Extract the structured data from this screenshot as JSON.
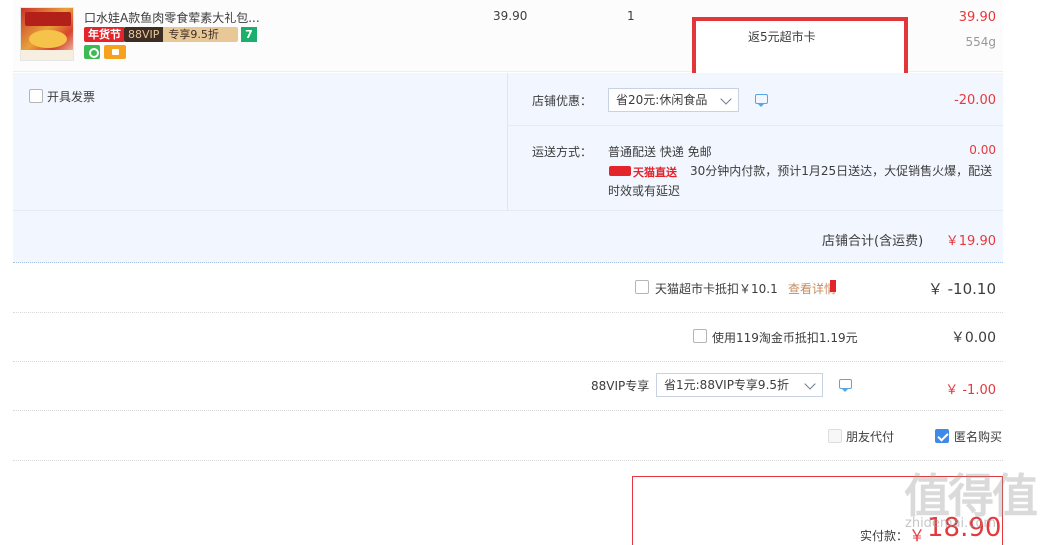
{
  "product": {
    "title": "口水娃A款鱼肉零食荤素大礼包...",
    "tag_festival": "年货节",
    "tag_vip_brand": "88VIP",
    "tag_vip_discount": "专享9.5折",
    "tag_seven": "7",
    "unit_price": "39.90",
    "quantity": "1",
    "rebate": "返5元超市卡",
    "total_price": "39.90",
    "weight": "554g"
  },
  "invoice": {
    "label": "开具发票"
  },
  "shop_discount": {
    "label": "店铺优惠：",
    "selected": "省20元:休闲食品",
    "amount": "-20.00"
  },
  "shipping": {
    "label": "运送方式：",
    "method": "普通配送 快递 免邮",
    "fee": "0.00",
    "tmall_direct": "天猫直送",
    "notice_line1": "30分钟内付款，预计1月25日送达，大促销售火爆，配送",
    "notice_line2": "时效或有延迟"
  },
  "shop_total": {
    "label": "店铺合计(含运费)",
    "value": "￥19.90"
  },
  "tmall_card": {
    "label": "天猫超市卡抵扣￥10.1",
    "details": "查看详情",
    "value": "￥ -10.10"
  },
  "taobao_coins": {
    "label": "使用119淘金币抵扣1.19元",
    "value": "￥0.00"
  },
  "vip": {
    "label": "88VIP专享",
    "selected": "省1元:88VIP专享9.5折",
    "value": "￥ -1.00"
  },
  "options": {
    "friend_pay": "朋友代付",
    "anonymous": "匿名购买"
  },
  "payment": {
    "label": "实付款：",
    "currency": "￥",
    "amount": "18.90"
  },
  "watermark": {
    "text": "值得值",
    "url": "zhidemai.com"
  },
  "colors": {
    "accent_red": "#e4393c",
    "blue_panel": "#f2f7ff",
    "checkbox_blue": "#3f8ae8"
  }
}
